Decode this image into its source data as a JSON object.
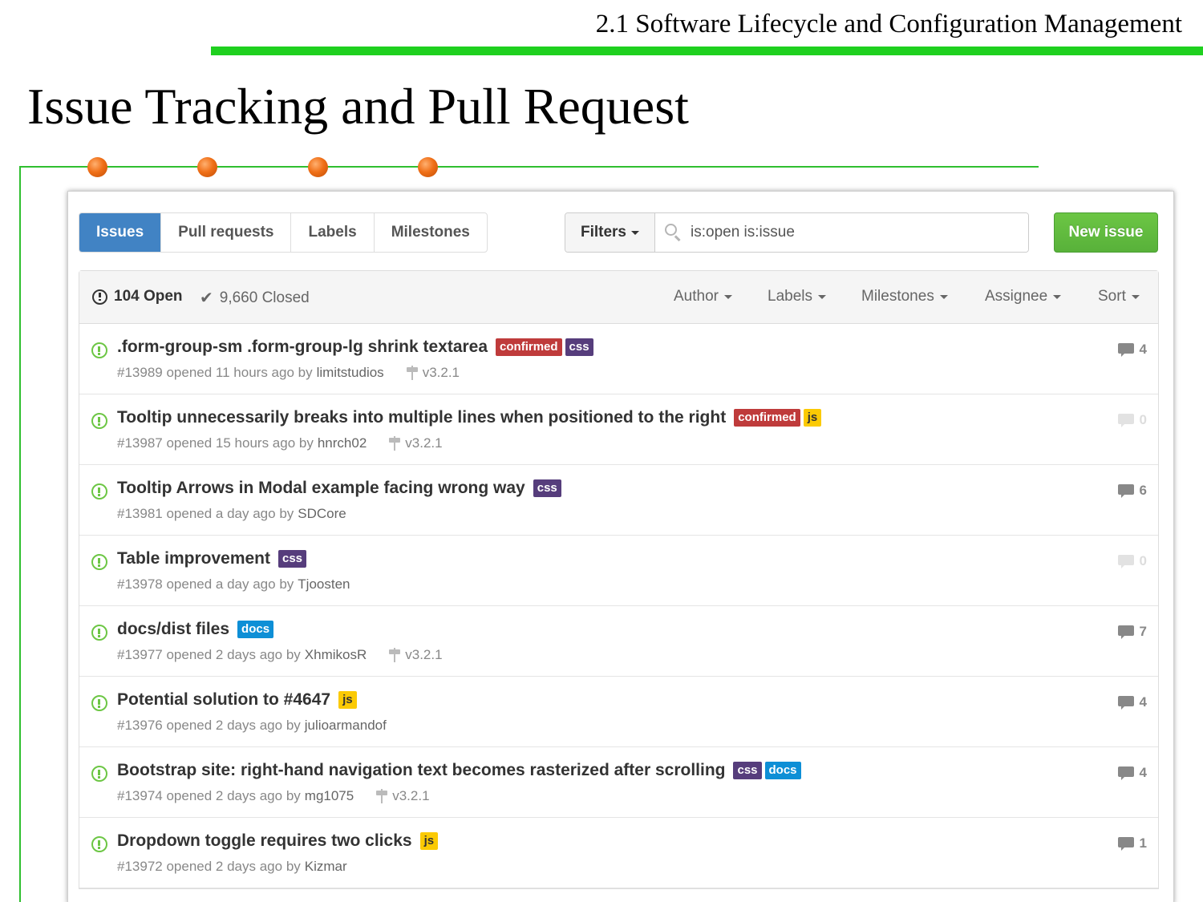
{
  "slide": {
    "header": "2.1 Software Lifecycle and Configuration Management",
    "title": "Issue Tracking and Pull Request"
  },
  "nav": {
    "tabs": [
      {
        "label": "Issues",
        "active": true
      },
      {
        "label": "Pull requests",
        "active": false
      },
      {
        "label": "Labels",
        "active": false
      },
      {
        "label": "Milestones",
        "active": false
      }
    ],
    "filters_label": "Filters",
    "search_value": "is:open is:issue",
    "new_issue_label": "New issue"
  },
  "list_header": {
    "open_count": "104 Open",
    "closed_count": "9,660 Closed",
    "filters": [
      "Author",
      "Labels",
      "Milestones",
      "Assignee",
      "Sort"
    ]
  },
  "label_colors": {
    "confirmed": "#bf3b3b",
    "css": "#563d7c",
    "js": "#fbca04",
    "docs": "#0e8fd6"
  },
  "issues": [
    {
      "title": ".form-group-sm .form-group-lg shrink textarea",
      "labels": [
        "confirmed",
        "css"
      ],
      "number": "#13989",
      "opened": "opened 11 hours ago by",
      "author": "limitstudios",
      "milestone": "v3.2.1",
      "comments": "4"
    },
    {
      "title": "Tooltip unnecessarily breaks into multiple lines when positioned to the right",
      "labels": [
        "confirmed",
        "js"
      ],
      "number": "#13987",
      "opened": "opened 15 hours ago by",
      "author": "hnrch02",
      "milestone": "v3.2.1",
      "comments": "0"
    },
    {
      "title": "Tooltip Arrows in Modal example facing wrong way",
      "labels": [
        "css"
      ],
      "number": "#13981",
      "opened": "opened a day ago by",
      "author": "SDCore",
      "milestone": "",
      "comments": "6"
    },
    {
      "title": "Table improvement",
      "labels": [
        "css"
      ],
      "number": "#13978",
      "opened": "opened a day ago by",
      "author": "Tjoosten",
      "milestone": "",
      "comments": "0"
    },
    {
      "title": "docs/dist files",
      "labels": [
        "docs"
      ],
      "number": "#13977",
      "opened": "opened 2 days ago by",
      "author": "XhmikosR",
      "milestone": "v3.2.1",
      "comments": "7"
    },
    {
      "title": "Potential solution to #4647",
      "labels": [
        "js"
      ],
      "number": "#13976",
      "opened": "opened 2 days ago by",
      "author": "julioarmandof",
      "milestone": "",
      "comments": "4"
    },
    {
      "title": "Bootstrap site: right-hand navigation text becomes rasterized after scrolling",
      "labels": [
        "css",
        "docs"
      ],
      "number": "#13974",
      "opened": "opened 2 days ago by",
      "author": "mg1075",
      "milestone": "v3.2.1",
      "comments": "4"
    },
    {
      "title": "Dropdown toggle requires two clicks",
      "labels": [
        "js"
      ],
      "number": "#13972",
      "opened": "opened 2 days ago by",
      "author": "Kizmar",
      "milestone": "",
      "comments": "1"
    }
  ]
}
